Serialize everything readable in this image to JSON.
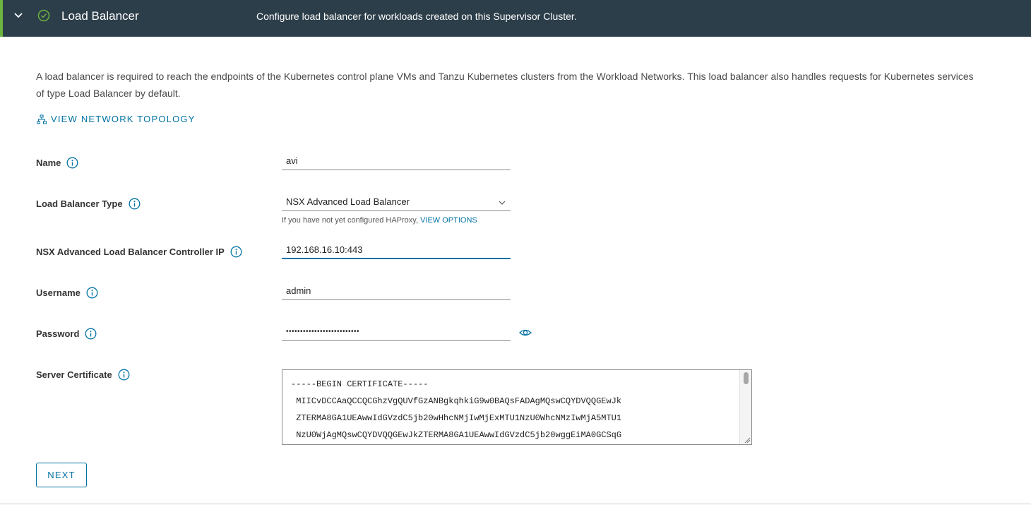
{
  "header": {
    "title": "Load Balancer",
    "description": "Configure load balancer for workloads created on this Supervisor Cluster.",
    "status": "complete"
  },
  "intro": "A load balancer is required to reach the endpoints of the Kubernetes control plane VMs and Tanzu Kubernetes clusters from the Workload Networks. This load balancer also handles requests for Kubernetes services of type Load Balancer by default.",
  "topology_link": "VIEW NETWORK TOPOLOGY",
  "form": {
    "name": {
      "label": "Name",
      "value": "avi"
    },
    "lb_type": {
      "label": "Load Balancer Type",
      "selected": "NSX Advanced Load Balancer",
      "helper_text": "If you have not yet configured HAProxy,",
      "helper_link": "VIEW OPTIONS"
    },
    "controller_ip": {
      "label": "NSX Advanced Load Balancer Controller IP",
      "value": "192.168.16.10:443"
    },
    "username": {
      "label": "Username",
      "value": "admin"
    },
    "password": {
      "label": "Password",
      "value": "••••••••••••••••••••••••••"
    },
    "certificate": {
      "label": "Server Certificate",
      "lines": [
        "-----BEGIN CERTIFICATE-----",
        " MIICvDCCAaQCCQCGhzVgQUVfGzANBgkqhkiG9w0BAQsFADAgMQswCQYDVQQGEwJk",
        " ZTERMA8GA1UEAwwIdGVzdC5jb20wHhcNMjIwMjExMTU1NzU0WhcNMzIwMjA5MTU1",
        " NzU0WjAgMQswCQYDVQQGEwJkZTERMA8GA1UEAwwIdGVzdC5jb20wggEiMA0GCSqG"
      ]
    }
  },
  "next_button": "NEXT",
  "colors": {
    "header_bg": "#2c3e4a",
    "accent": "#0072a3",
    "success": "#6db33f"
  }
}
